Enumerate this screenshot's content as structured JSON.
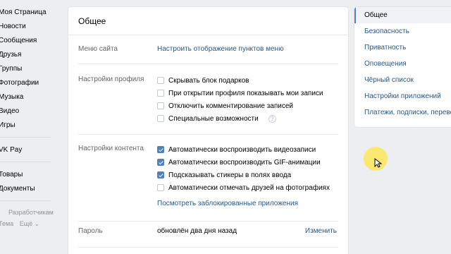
{
  "sidebar": {
    "items": [
      {
        "label": "Моя Страница"
      },
      {
        "label": "Новости"
      },
      {
        "label": "Сообщения"
      },
      {
        "label": "Друзья"
      },
      {
        "label": "Группы"
      },
      {
        "label": "Фотографии"
      },
      {
        "label": "Музыка"
      },
      {
        "label": "Видео"
      },
      {
        "label": "Игры"
      }
    ],
    "pay": {
      "label": "VK Pay"
    },
    "extra": [
      {
        "label": "Товары"
      },
      {
        "label": "Документы"
      }
    ],
    "footer": {
      "developers": "Разработчикам",
      "theme": "Тема",
      "more": "Ещё ⌄"
    }
  },
  "main": {
    "title": "Общее",
    "site_menu": {
      "label": "Меню сайта",
      "link": "Настроить отображение пунктов меню"
    },
    "profile": {
      "label": "Настройки профиля",
      "options": [
        {
          "text": "Скрывать блок подарков",
          "checked": false
        },
        {
          "text": "При открытии профиля показывать мои записи",
          "checked": false
        },
        {
          "text": "Отключить комментирование записей",
          "checked": false
        },
        {
          "text": "Специальные возможности",
          "checked": false
        }
      ],
      "help": "?"
    },
    "content": {
      "label": "Настройки контента",
      "options": [
        {
          "text": "Автоматически воспроизводить видеозаписи",
          "checked": true
        },
        {
          "text": "Автоматически воспроизводить GIF-анимации",
          "checked": true
        },
        {
          "text": "Подсказывать стикеры в полях ввода",
          "checked": true
        },
        {
          "text": "Автоматически отмечать друзей на фотографиях",
          "checked": false
        }
      ],
      "blocked_link": "Посмотреть заблокированные приложения"
    },
    "password": {
      "label": "Пароль",
      "value": "обновлён два дня назад",
      "action": "Изменить"
    }
  },
  "right_menu": {
    "items": [
      {
        "label": "Общее",
        "active": true
      },
      {
        "label": "Безопасность"
      },
      {
        "label": "Приватность"
      },
      {
        "label": "Оповещения"
      },
      {
        "label": "Чёрный список"
      },
      {
        "label": "Настройки приложений"
      },
      {
        "label": "Платежи, подписки, переводы"
      }
    ]
  },
  "colors": {
    "accent": "#5181b8",
    "link": "#2a5885",
    "background": "#edeef0",
    "cursor_highlight": "#ffe646"
  }
}
